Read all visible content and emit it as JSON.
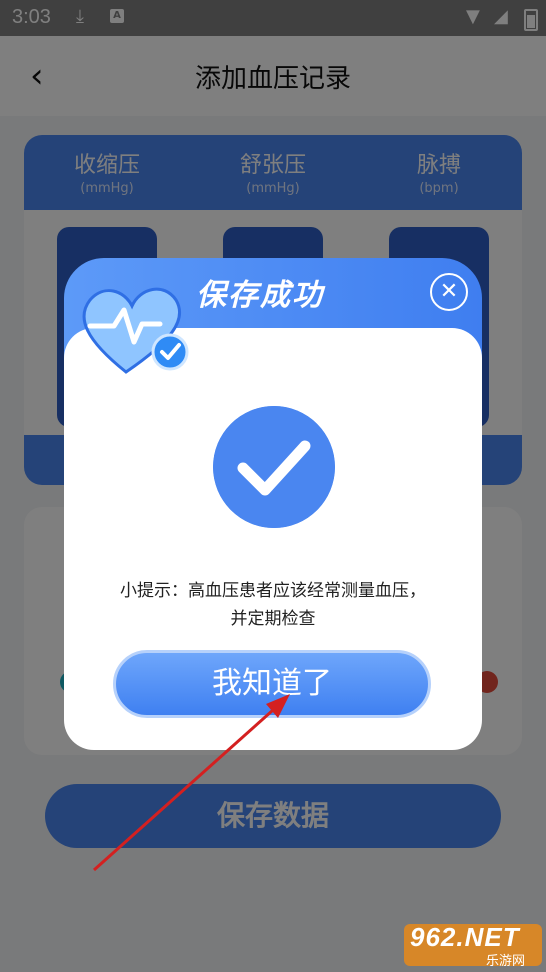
{
  "status_bar": {
    "time": "3:03",
    "download_icon": "download-icon",
    "app_icon_text": "A"
  },
  "appbar": {
    "back_icon": "back-arrow-icon",
    "title": "添加血压记录"
  },
  "card": {
    "columns": [
      {
        "label": "收缩压",
        "unit": "(mmHg)"
      },
      {
        "label": "舒张压",
        "unit": "(mmHg)"
      },
      {
        "label": "脉搏",
        "unit": "(bpm)"
      }
    ]
  },
  "save_button": "保存数据",
  "dialog": {
    "title": "保存成功",
    "close_icon": "close-icon",
    "tip_line1": "小提示：高血压患者应该经常测量血压，",
    "tip_line2": "并定期检查",
    "ok_button": "我知道了"
  },
  "watermark": {
    "text": "962.NET",
    "sub": "乐游网"
  },
  "colors": {
    "accent": "#4a86f0",
    "overlay": "rgba(0,0,0,0.5)",
    "arrow": "#d42020"
  }
}
